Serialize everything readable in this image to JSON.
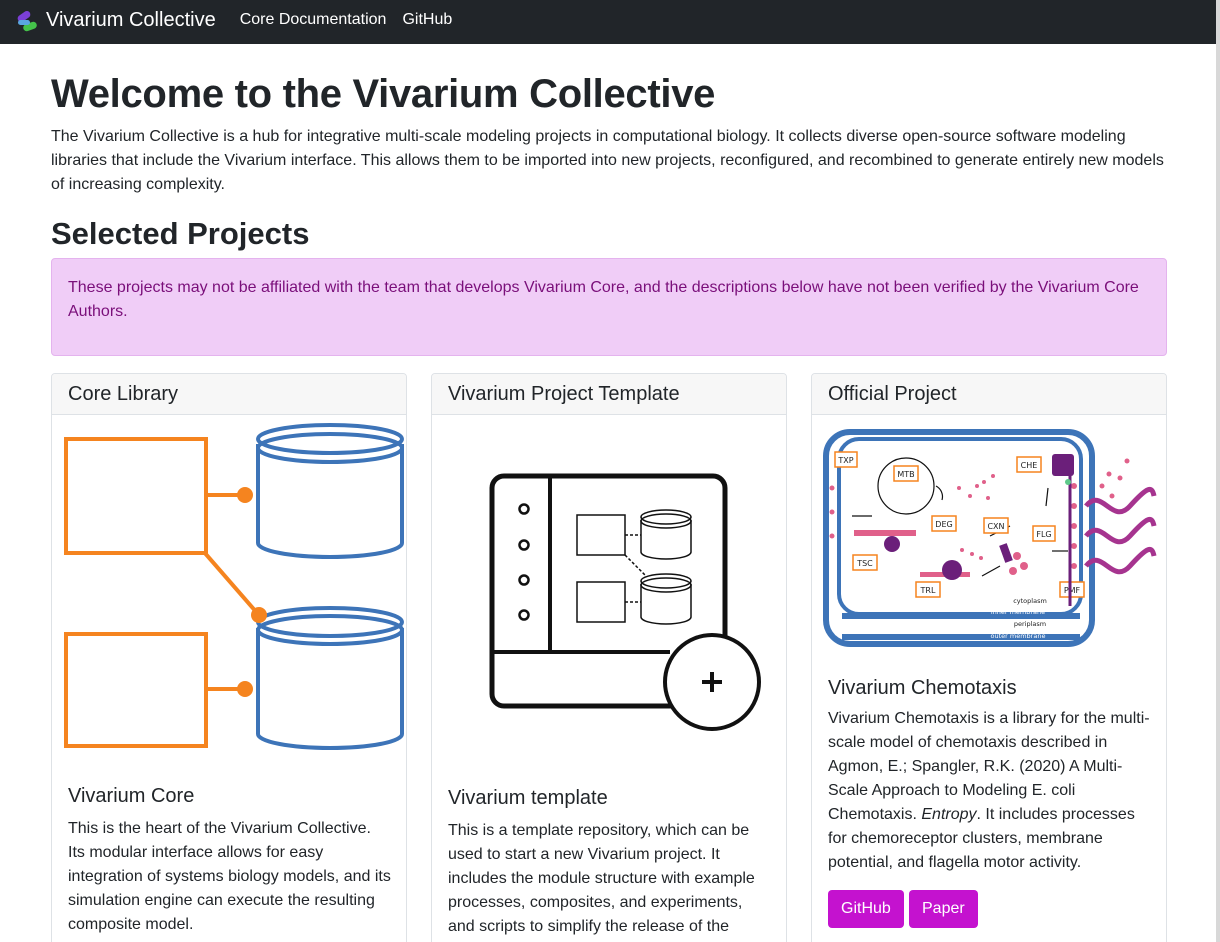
{
  "navbar": {
    "brand": "Vivarium Collective",
    "links": [
      "Core Documentation",
      "GitHub"
    ]
  },
  "page": {
    "title": "Welcome to the Vivarium Collective",
    "intro": "The Vivarium Collective is a hub for integrative multi-scale modeling projects in computational biology. It collects diverse open-source software modeling libraries that include the Vivarium interface. This allows them to be imported into new projects, reconfigured, and recombined to generate entirely new models of increasing complexity.",
    "section_title": "Selected Projects",
    "alert": "These projects may not be affiliated with the team that develops Vivarium Core, and the descriptions below have not been verified by the Vivarium Core Authors."
  },
  "cards": [
    {
      "header": "Core Library",
      "title": "Vivarium Core",
      "text": "This is the heart of the Vivarium Collective. Its modular interface allows for easy integration of systems biology models, and its simulation engine can execute the resulting composite model."
    },
    {
      "header": "Vivarium Project Template",
      "title": "Vivarium template",
      "text": "This is a template repository, which can be used to start a new Vivarium project. It includes the module structure with example processes, composites, and experiments, and scripts to simplify the release of the project."
    },
    {
      "header": "Official Project",
      "title": "Vivarium Chemotaxis",
      "text_before": "Vivarium Chemotaxis is a library for the multi-scale model of chemotaxis described in Agmon, E.; Spangler, R.K. (2020) A Multi-Scale Approach to Modeling E. coli Chemotaxis. ",
      "text_em": "Entropy",
      "text_after": ". It includes processes for chemoreceptor clusters, membrane potential, and flagella motor activity.",
      "buttons": [
        "GitHub",
        "Paper"
      ],
      "figure": {
        "modules": [
          "TXP",
          "MTB",
          "CHE",
          "DEG",
          "CXN",
          "FLG",
          "TSC",
          "TRL",
          "PMF"
        ],
        "compartments": [
          "cytoplasm",
          "inner membrane",
          "periplasm",
          "outer membrane"
        ]
      }
    }
  ],
  "colors": {
    "navbar_bg": "#212529",
    "alert_bg": "#f0cdf7",
    "alert_text": "#7a0f7a",
    "button_bg": "#c412cf",
    "diagram_orange": "#f5841f",
    "diagram_blue": "#3d74b8"
  },
  "icons": {
    "brand_logo": "vivarium-logo-icon",
    "template_add": "plus-circle-icon"
  }
}
